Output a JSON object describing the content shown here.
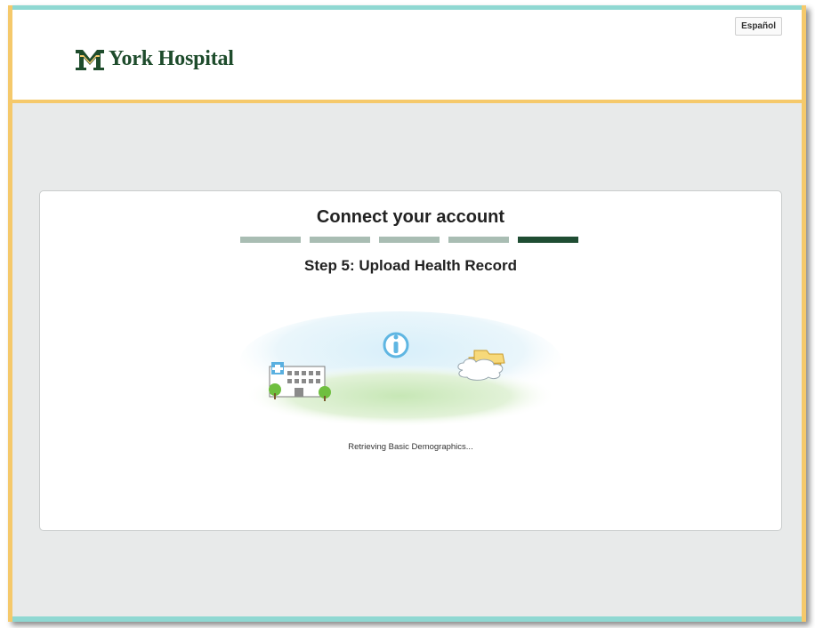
{
  "header": {
    "logo_text": "York Hospital",
    "language_button": "Español"
  },
  "card": {
    "title": "Connect your account",
    "steps": [
      {
        "state": "complete"
      },
      {
        "state": "complete"
      },
      {
        "state": "complete"
      },
      {
        "state": "complete"
      },
      {
        "state": "current"
      }
    ],
    "step_title": "Step 5: Upload Health Record",
    "status_text": "Retrieving Basic Demographics..."
  },
  "colors": {
    "brand_green": "#1e4c2c",
    "accent_orange": "#f5c96b",
    "accent_teal": "#8fd8d2",
    "step_complete": "#a9bdb3",
    "step_current": "#1f4d33"
  }
}
